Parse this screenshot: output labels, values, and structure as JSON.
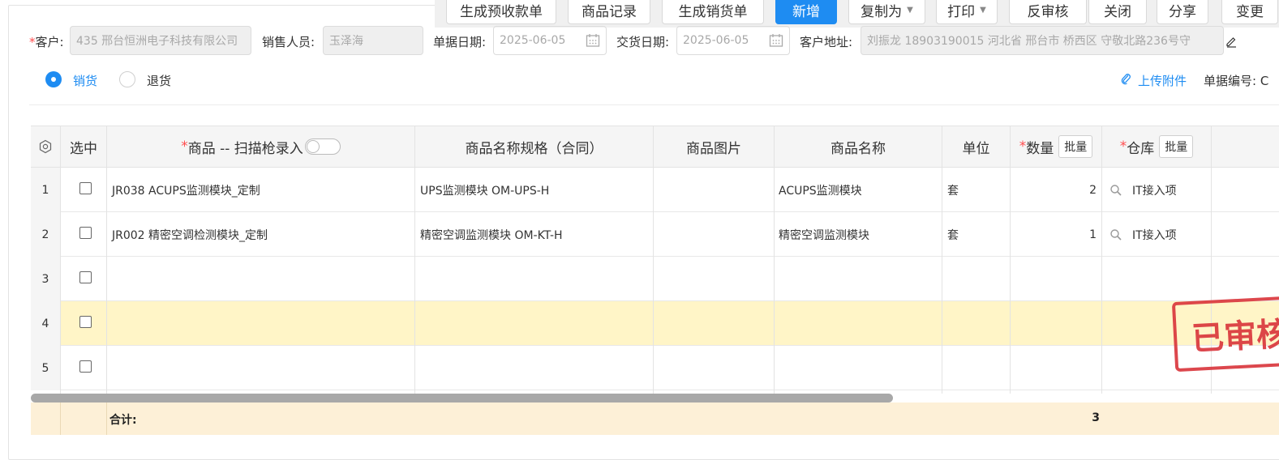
{
  "toolbar": {
    "buttons": [
      {
        "label": "生成预收款单"
      },
      {
        "label": "商品记录"
      },
      {
        "label": "生成销货单"
      },
      {
        "label": "新增"
      },
      {
        "label": "复制为"
      },
      {
        "label": "打印"
      },
      {
        "label": "反审核"
      },
      {
        "label": "关闭"
      },
      {
        "label": "分享"
      },
      {
        "label": "变更"
      }
    ]
  },
  "form": {
    "customer_label": "客户:",
    "customer_value": "435 邢台恒洲电子科技有限公司",
    "sales_label": "销售人员:",
    "sales_value": "玉泽海",
    "doc_date_label": "单据日期:",
    "doc_date_value": "2025-06-05",
    "delivery_date_label": "交货日期:",
    "delivery_date_value": "2025-06-05",
    "address_label": "客户地址:",
    "address_value": "刘振龙 18903190015 河北省 邢台市 桥西区 守敬北路236号守",
    "radio_sale": "销货",
    "radio_return": "退货",
    "upload_label": "上传附件",
    "doc_no_label": "单据编号: C"
  },
  "table": {
    "headers": {
      "select": "选中",
      "product": "商品 -- 扫描枪录入",
      "spec": "商品名称规格（合同）",
      "image": "商品图片",
      "name": "商品名称",
      "unit": "单位",
      "qty": "数量",
      "qty_batch": "批量",
      "warehouse": "仓库",
      "warehouse_batch": "批量"
    },
    "rows": [
      {
        "no": "1",
        "product": "JR038 ACUPS监测模块_定制",
        "spec": "UPS监测模块 OM-UPS-H",
        "name": "ACUPS监测模块",
        "unit": "套",
        "qty": "2",
        "warehouse": "IT接入项"
      },
      {
        "no": "2",
        "product": "JR002 精密空调检测模块_定制",
        "spec": "精密空调监测模块 OM-KT-H",
        "name": "精密空调监测模块",
        "unit": "套",
        "qty": "1",
        "warehouse": "IT接入项"
      },
      {
        "no": "3",
        "product": "",
        "spec": "",
        "name": "",
        "unit": "",
        "qty": "",
        "warehouse": ""
      },
      {
        "no": "4",
        "product": "",
        "spec": "",
        "name": "",
        "unit": "",
        "qty": "",
        "warehouse": ""
      },
      {
        "no": "5",
        "product": "",
        "spec": "",
        "name": "",
        "unit": "",
        "qty": "",
        "warehouse": ""
      }
    ],
    "footer_label": "合计:",
    "footer_qty": "3"
  },
  "stamp_text": "已审核",
  "colors": {
    "primary": "#1e8cf2",
    "stamp": "#d9343a",
    "highlight_row": "#fff5c7",
    "footer": "#fdf0d7"
  }
}
